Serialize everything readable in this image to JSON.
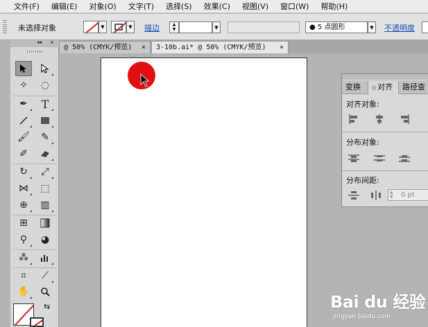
{
  "menu": [
    "文件(F)",
    "编辑(E)",
    "对象(O)",
    "文字(T)",
    "选择(S)",
    "效果(C)",
    "视图(V)",
    "窗口(W)",
    "帮助(H)"
  ],
  "control": {
    "selection_status": "未选择对象",
    "stroke_label": "描边",
    "brush_value": "● 5 点圆形",
    "opacity_label": "不透明度"
  },
  "tabs": [
    {
      "label": "@ 50% (CMYK/预览)",
      "close": "×",
      "active": false
    },
    {
      "label": "3-10b.ai* @ 50% (CMYK/预览)",
      "close": "×",
      "active": true
    }
  ],
  "tools_panel": {
    "collapse": "◂◂",
    "close": "x"
  },
  "align_panel": {
    "tabs": [
      "变换",
      "对齐",
      "路径查"
    ],
    "active_tab_marker": "◇",
    "sections": {
      "align_objects": "对齐对象:",
      "distribute_objects": "分布对象:",
      "distribute_spacing": "分布间距:"
    },
    "spacing_value": "0 pt"
  },
  "watermark": {
    "logo": "Bai du 经验",
    "url": "jingyan.baidu.com"
  },
  "colors": {
    "marker": "#e01010",
    "stroke_none": "#d42020",
    "link": "#1a4fb6"
  }
}
